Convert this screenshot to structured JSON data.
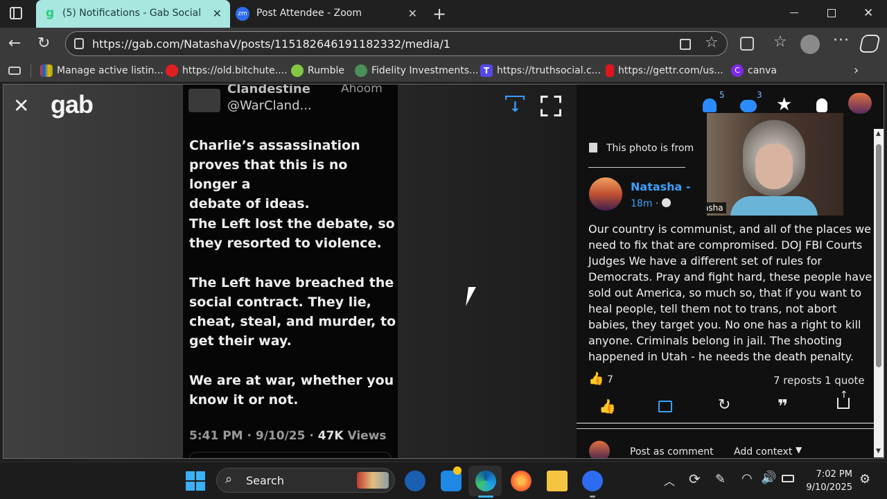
{
  "browser": {
    "tabs": [
      {
        "title": "(5) Notifications - Gab Social",
        "icon_label": "g"
      },
      {
        "title": "Post Attendee - Zoom",
        "icon_label": "zm"
      }
    ],
    "url": "https://gab.com/NatashaV/posts/115182646191182332/media/1",
    "bookmarks": [
      {
        "label": "Manage active listin..."
      },
      {
        "label": "https://old.bitchute...."
      },
      {
        "label": "Rumble"
      },
      {
        "label": "Fidelity Investments..."
      },
      {
        "label": "https://truthsocial.c...",
        "icon_label": "T"
      },
      {
        "label": "https://gettr.com/us..."
      },
      {
        "label": "canva",
        "icon_label": "C"
      }
    ]
  },
  "gab": {
    "logo": "gab",
    "tweet": {
      "header_name": "Clandestine",
      "header_time": "Ahoom",
      "handle": "@WarCland...",
      "paragraphs": [
        [
          "Charlie’s assassination",
          "proves that this is no longer a",
          "debate of ideas."
        ],
        [
          "The Left lost the debate, so",
          "they resorted to violence."
        ],
        [
          "The Left have breached the",
          "social contract. They lie,",
          "cheat, steal, and murder, to",
          "get their way."
        ],
        [
          "We are at war, whether you",
          "know it or not."
        ]
      ],
      "footer_time": "5:41 PM · 9/10/25 · ",
      "footer_views": "47K",
      "footer_views_label": " Views"
    },
    "nav": {
      "notif_count": "5",
      "chat_count": "3"
    },
    "panel": {
      "photo_notice": "This photo is from",
      "author_name": "Natasha -",
      "post_time": "18m",
      "post_time_sep": " · ",
      "post_text_lines": [
        "Our country is communist, and all of the places we",
        "need to fix that are compromised. DOJ FBI Courts",
        "Judges We have a different set of rules for",
        "Democrats. Pray and fight hard, these people have",
        "sold out America, so much so, that if you want to",
        "heal people, tell them not to trans, not abort",
        "babies, they target you. No one has a right to kill",
        "anyone. Criminals belong in jail. The shooting",
        "happened in Utah - he needs the death penalty."
      ],
      "like_count": "7",
      "reposts": "7 reposts",
      "quotes": "1 quote",
      "post_as_comment": "Post as comment",
      "add_context": "Add context"
    }
  },
  "zoom": {
    "participant_name": "Natasha"
  },
  "taskbar": {
    "search_label": "Search",
    "time": "7:02 PM",
    "date": "9/10/2025"
  }
}
